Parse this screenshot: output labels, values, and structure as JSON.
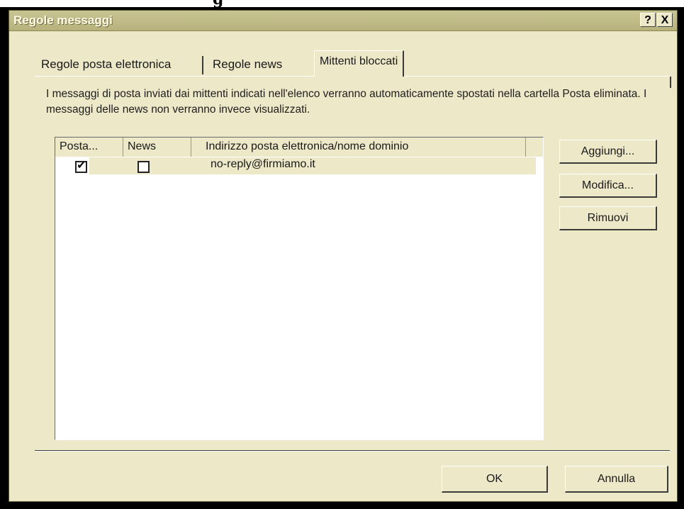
{
  "window": {
    "title": "Regole messaggi",
    "help_button": "?",
    "close_button": "X"
  },
  "tabs": [
    {
      "label": "Regole posta elettronica",
      "active": false
    },
    {
      "label": "Regole news",
      "active": false
    },
    {
      "label": "Mittenti bloccati",
      "active": true
    }
  ],
  "description": "I messaggi di posta inviati dai mittenti indicati nell'elenco verranno automaticamente spostati nella cartella Posta eliminata. I messaggi delle news non verranno invece visualizzati.",
  "list": {
    "columns": [
      "Posta...",
      "News",
      "Indirizzo posta elettronica/nome dominio"
    ],
    "rows": [
      {
        "posta": true,
        "news": false,
        "address": "no-reply@firmiamo.it"
      }
    ]
  },
  "side_buttons": {
    "add": "Aggiungi...",
    "edit": "Modifica...",
    "remove": "Rimuovi"
  },
  "footer": {
    "ok": "OK",
    "cancel": "Annulla"
  },
  "top_fragment": "g"
}
